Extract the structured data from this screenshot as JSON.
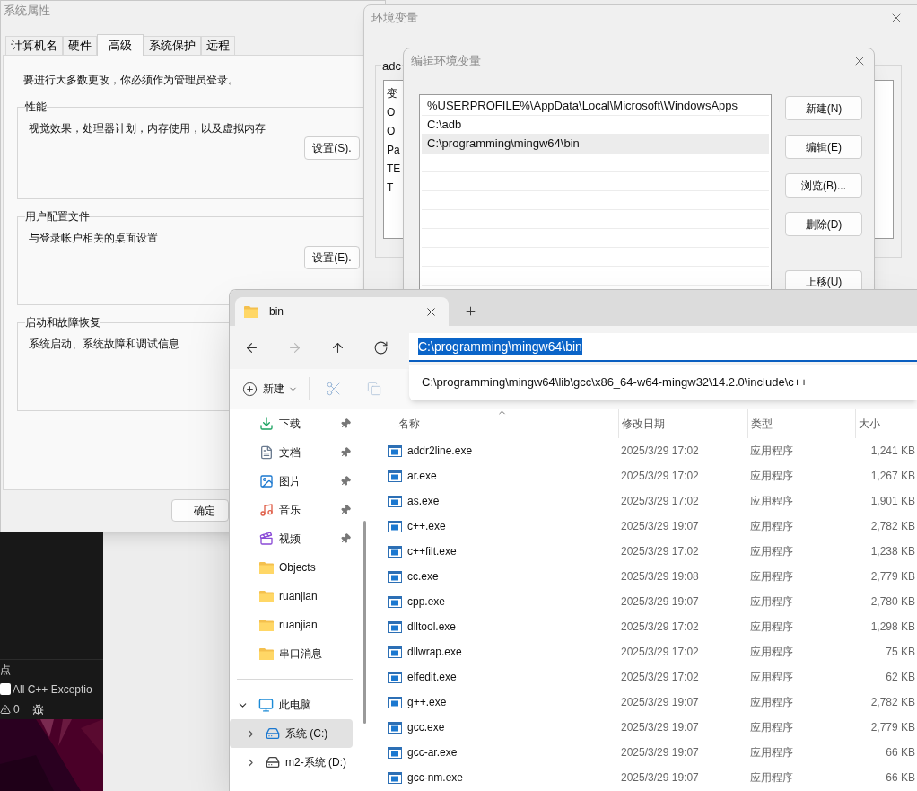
{
  "system_properties": {
    "title": "系统属性",
    "tabs": [
      {
        "label": "计算机名",
        "selected": false
      },
      {
        "label": "硬件",
        "selected": false
      },
      {
        "label": "高级",
        "selected": true
      },
      {
        "label": "系统保护",
        "selected": false
      },
      {
        "label": "远程",
        "selected": false
      }
    ],
    "notice": "要进行大多数更改，你必须作为管理员登录。",
    "groups": [
      {
        "title": "性能",
        "description": "视觉效果，处理器计划，内存使用，以及虚拟内存",
        "button": "设置(S)."
      },
      {
        "title": "用户配置文件",
        "description": "与登录帐户相关的桌面设置",
        "button": "设置(E)."
      },
      {
        "title": "启动和故障恢复",
        "description": "系统启动、系统故障和调试信息"
      }
    ],
    "ok_button": "确定"
  },
  "environment_variables": {
    "title": "环境变量",
    "group_label": "adc",
    "rows": [
      "变",
      "O",
      "O",
      "Pa",
      "TE",
      "T"
    ]
  },
  "edit_dialog": {
    "title": "编辑环境变量",
    "paths": [
      {
        "text": "%USERPROFILE%\\AppData\\Local\\Microsoft\\WindowsApps",
        "selected": false
      },
      {
        "text": "C:\\adb",
        "selected": false
      },
      {
        "text": "C:\\programming\\mingw64\\bin",
        "selected": true
      }
    ],
    "buttons": [
      "新建(N)",
      "编辑(E)",
      "浏览(B)...",
      "删除(D)",
      "上移(U)"
    ]
  },
  "explorer": {
    "tab_title": "bin",
    "nav_buttons": [
      {
        "kind": "back",
        "disabled": false
      },
      {
        "kind": "forward",
        "disabled": true
      },
      {
        "kind": "up",
        "disabled": false
      },
      {
        "kind": "refresh",
        "disabled": false
      }
    ],
    "address": {
      "value": "C:\\programming\\mingw64\\bin",
      "suggestion": "C:\\programming\\mingw64\\lib\\gcc\\x86_64-w64-mingw32\\14.2.0\\include\\c++"
    },
    "new_label": "新建",
    "quick_access": [
      {
        "label": "下载",
        "kind": "download",
        "pinned": true
      },
      {
        "label": "文档",
        "kind": "document",
        "pinned": true
      },
      {
        "label": "图片",
        "kind": "picture",
        "pinned": true
      },
      {
        "label": "音乐",
        "kind": "music",
        "pinned": true
      },
      {
        "label": "视频",
        "kind": "video",
        "pinned": true
      },
      {
        "label": "Objects",
        "kind": "folder",
        "pinned": false
      },
      {
        "label": "ruanjian",
        "kind": "folder",
        "pinned": false
      },
      {
        "label": "ruanjian",
        "kind": "folder",
        "pinned": false
      },
      {
        "label": "串口消息",
        "kind": "folder",
        "pinned": false
      }
    ],
    "this_pc": {
      "label": "此电脑",
      "expanded": true,
      "children": [
        {
          "label": "系统 (C:)",
          "kind": "system-drive",
          "selected": true
        },
        {
          "label": "m2-系统 (D:)",
          "kind": "drive",
          "selected": false
        }
      ]
    },
    "columns": [
      "名称",
      "修改日期",
      "类型",
      "大小"
    ],
    "files": [
      {
        "name": "addr2line.exe",
        "modified": "2025/3/29 17:02",
        "type": "应用程序",
        "size": "1,241 KB"
      },
      {
        "name": "ar.exe",
        "modified": "2025/3/29 17:02",
        "type": "应用程序",
        "size": "1,267 KB"
      },
      {
        "name": "as.exe",
        "modified": "2025/3/29 17:02",
        "type": "应用程序",
        "size": "1,901 KB"
      },
      {
        "name": "c++.exe",
        "modified": "2025/3/29 19:07",
        "type": "应用程序",
        "size": "2,782 KB"
      },
      {
        "name": "c++filt.exe",
        "modified": "2025/3/29 17:02",
        "type": "应用程序",
        "size": "1,238 KB"
      },
      {
        "name": "cc.exe",
        "modified": "2025/3/29 19:08",
        "type": "应用程序",
        "size": "2,779 KB"
      },
      {
        "name": "cpp.exe",
        "modified": "2025/3/29 19:07",
        "type": "应用程序",
        "size": "2,780 KB"
      },
      {
        "name": "dlltool.exe",
        "modified": "2025/3/29 17:02",
        "type": "应用程序",
        "size": "1,298 KB"
      },
      {
        "name": "dllwrap.exe",
        "modified": "2025/3/29 17:02",
        "type": "应用程序",
        "size": "75 KB"
      },
      {
        "name": "elfedit.exe",
        "modified": "2025/3/29 17:02",
        "type": "应用程序",
        "size": "62 KB"
      },
      {
        "name": "g++.exe",
        "modified": "2025/3/29 19:07",
        "type": "应用程序",
        "size": "2,782 KB"
      },
      {
        "name": "gcc.exe",
        "modified": "2025/3/29 19:07",
        "type": "应用程序",
        "size": "2,779 KB"
      },
      {
        "name": "gcc-ar.exe",
        "modified": "2025/3/29 19:07",
        "type": "应用程序",
        "size": "66 KB"
      },
      {
        "name": "gcc-nm.exe",
        "modified": "2025/3/29 19:07",
        "type": "应用程序",
        "size": "66 KB"
      }
    ]
  },
  "debug_panel": {
    "section_title": "点",
    "exception": {
      "label": "All C++ Exceptio",
      "checked": false
    },
    "warning_count": "0"
  }
}
